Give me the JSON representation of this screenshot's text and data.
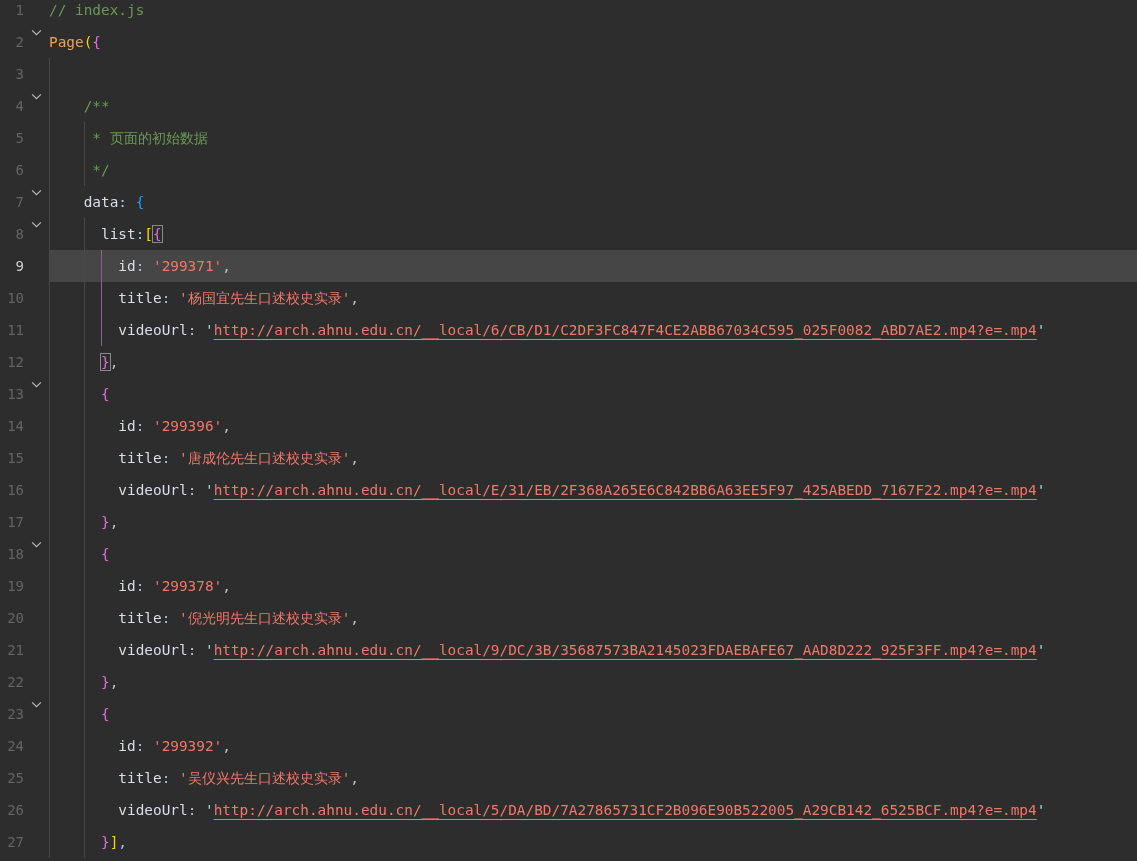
{
  "editor": {
    "lines": [
      {
        "number": "1",
        "foldable": false,
        "current": false,
        "scope_highlight": false,
        "tokens": [
          {
            "kind": "comment",
            "text": "// index.js"
          }
        ]
      },
      {
        "number": "2",
        "foldable": true,
        "current": false,
        "scope_highlight": false,
        "tokens": [
          {
            "kind": "function",
            "text": "Page"
          },
          {
            "kind": "bracket-gold",
            "text": "("
          },
          {
            "kind": "bracket-pink",
            "text": "{"
          }
        ]
      },
      {
        "number": "3",
        "foldable": false,
        "current": false,
        "scope_highlight": false
      },
      {
        "number": "4",
        "foldable": true,
        "current": false,
        "scope_highlight": false,
        "tokens": [
          {
            "kind": "comment",
            "text": "    /**"
          }
        ]
      },
      {
        "number": "5",
        "foldable": false,
        "current": false,
        "scope_highlight": false,
        "tokens": [
          {
            "kind": "comment",
            "text": "     * 页面的初始数据"
          }
        ]
      },
      {
        "number": "6",
        "foldable": false,
        "current": false,
        "scope_highlight": false,
        "tokens": [
          {
            "kind": "comment",
            "text": "     */"
          }
        ]
      },
      {
        "number": "7",
        "foldable": true,
        "current": false,
        "scope_highlight": false,
        "tokens": [
          {
            "kind": "property",
            "text": "    data"
          },
          {
            "kind": "punct",
            "text": ": "
          },
          {
            "kind": "bracket-blue",
            "text": "{"
          }
        ]
      },
      {
        "number": "8",
        "foldable": true,
        "current": false,
        "scope_highlight": false,
        "tokens": [
          {
            "kind": "property",
            "text": "      list"
          },
          {
            "kind": "punct",
            "text": ":"
          },
          {
            "kind": "bracket-gold",
            "text": "["
          },
          {
            "kind": "bracket-pink",
            "text": "{",
            "matched": true
          }
        ]
      },
      {
        "number": "9",
        "foldable": false,
        "current": true,
        "scope_highlight": true,
        "tokens": [
          {
            "kind": "property",
            "text": "        id"
          },
          {
            "kind": "punct",
            "text": ": "
          },
          {
            "kind": "string",
            "text": "'299371'"
          },
          {
            "kind": "punct",
            "text": ","
          }
        ]
      },
      {
        "number": "10",
        "foldable": false,
        "current": false,
        "scope_highlight": true,
        "tokens": [
          {
            "kind": "property",
            "text": "        title"
          },
          {
            "kind": "punct",
            "text": ": "
          },
          {
            "kind": "string",
            "text": "'杨国宜先生口述校史实录'"
          },
          {
            "kind": "punct",
            "text": ","
          }
        ]
      },
      {
        "number": "11",
        "foldable": false,
        "current": false,
        "scope_highlight": true,
        "tokens": [
          {
            "kind": "property",
            "text": "        videoUrl"
          },
          {
            "kind": "punct",
            "text": ": "
          },
          {
            "kind": "quote",
            "text": "'"
          },
          {
            "kind": "link",
            "text": "http://arch.ahnu.edu.cn/__local/6/CB/D1/C2DF3FC847F4CE2ABB67034C595_025F0082_ABD7AE2.mp4?e=.mp4"
          },
          {
            "kind": "quote",
            "text": "'"
          }
        ]
      },
      {
        "number": "12",
        "foldable": false,
        "current": false,
        "scope_highlight": false,
        "tokens": [
          {
            "kind": "bracket-pink",
            "text": "      }",
            "matched": true
          },
          {
            "kind": "punct",
            "text": ","
          }
        ]
      },
      {
        "number": "13",
        "foldable": true,
        "current": false,
        "scope_highlight": false,
        "tokens": [
          {
            "kind": "bracket-pink",
            "text": "      {"
          }
        ]
      },
      {
        "number": "14",
        "foldable": false,
        "current": false,
        "scope_highlight": false,
        "tokens": [
          {
            "kind": "property",
            "text": "        id"
          },
          {
            "kind": "punct",
            "text": ": "
          },
          {
            "kind": "string",
            "text": "'299396'"
          },
          {
            "kind": "punct",
            "text": ","
          }
        ]
      },
      {
        "number": "15",
        "foldable": false,
        "current": false,
        "scope_highlight": false,
        "tokens": [
          {
            "kind": "property",
            "text": "        title"
          },
          {
            "kind": "punct",
            "text": ": "
          },
          {
            "kind": "string",
            "text": "'唐成伦先生口述校史实录'"
          },
          {
            "kind": "punct",
            "text": ","
          }
        ]
      },
      {
        "number": "16",
        "foldable": false,
        "current": false,
        "scope_highlight": false,
        "tokens": [
          {
            "kind": "property",
            "text": "        videoUrl"
          },
          {
            "kind": "punct",
            "text": ": "
          },
          {
            "kind": "quote",
            "text": "'"
          },
          {
            "kind": "link",
            "text": "http://arch.ahnu.edu.cn/__local/E/31/EB/2F368A265E6C842BB6A63EE5F97_425ABEDD_7167F22.mp4?e=.mp4"
          },
          {
            "kind": "quote",
            "text": "'"
          }
        ]
      },
      {
        "number": "17",
        "foldable": false,
        "current": false,
        "scope_highlight": false,
        "tokens": [
          {
            "kind": "bracket-pink",
            "text": "      }"
          },
          {
            "kind": "punct",
            "text": ","
          }
        ]
      },
      {
        "number": "18",
        "foldable": true,
        "current": false,
        "scope_highlight": false,
        "tokens": [
          {
            "kind": "bracket-pink",
            "text": "      {"
          }
        ]
      },
      {
        "number": "19",
        "foldable": false,
        "current": false,
        "scope_highlight": false,
        "tokens": [
          {
            "kind": "property",
            "text": "        id"
          },
          {
            "kind": "punct",
            "text": ": "
          },
          {
            "kind": "string",
            "text": "'299378'"
          },
          {
            "kind": "punct",
            "text": ","
          }
        ]
      },
      {
        "number": "20",
        "foldable": false,
        "current": false,
        "scope_highlight": false,
        "tokens": [
          {
            "kind": "property",
            "text": "        title"
          },
          {
            "kind": "punct",
            "text": ": "
          },
          {
            "kind": "string",
            "text": "'倪光明先生口述校史实录'"
          },
          {
            "kind": "punct",
            "text": ","
          }
        ]
      },
      {
        "number": "21",
        "foldable": false,
        "current": false,
        "scope_highlight": false,
        "tokens": [
          {
            "kind": "property",
            "text": "        videoUrl"
          },
          {
            "kind": "punct",
            "text": ": "
          },
          {
            "kind": "quote",
            "text": "'"
          },
          {
            "kind": "link",
            "text": "http://arch.ahnu.edu.cn/__local/9/DC/3B/35687573BA2145023FDAEBAFE67_AAD8D222_925F3FF.mp4?e=.mp4"
          },
          {
            "kind": "quote",
            "text": "'"
          }
        ]
      },
      {
        "number": "22",
        "foldable": false,
        "current": false,
        "scope_highlight": false,
        "tokens": [
          {
            "kind": "bracket-pink",
            "text": "      }"
          },
          {
            "kind": "punct",
            "text": ","
          }
        ]
      },
      {
        "number": "23",
        "foldable": true,
        "current": false,
        "scope_highlight": false,
        "tokens": [
          {
            "kind": "bracket-pink",
            "text": "      {"
          }
        ]
      },
      {
        "number": "24",
        "foldable": false,
        "current": false,
        "scope_highlight": false,
        "tokens": [
          {
            "kind": "property",
            "text": "        id"
          },
          {
            "kind": "punct",
            "text": ": "
          },
          {
            "kind": "string",
            "text": "'299392'"
          },
          {
            "kind": "punct",
            "text": ","
          }
        ]
      },
      {
        "number": "25",
        "foldable": false,
        "current": false,
        "scope_highlight": false,
        "tokens": [
          {
            "kind": "property",
            "text": "        title"
          },
          {
            "kind": "punct",
            "text": ": "
          },
          {
            "kind": "string",
            "text": "'吴仪兴先生口述校史实录'"
          },
          {
            "kind": "punct",
            "text": ","
          }
        ]
      },
      {
        "number": "26",
        "foldable": false,
        "current": false,
        "scope_highlight": false,
        "tokens": [
          {
            "kind": "property",
            "text": "        videoUrl"
          },
          {
            "kind": "punct",
            "text": ": "
          },
          {
            "kind": "quote",
            "text": "'"
          },
          {
            "kind": "link",
            "text": "http://arch.ahnu.edu.cn/__local/5/DA/BD/7A27865731CF2B096E90B522005_A29CB142_6525BCF.mp4?e=.mp4"
          },
          {
            "kind": "quote",
            "text": "'"
          }
        ]
      },
      {
        "number": "27",
        "foldable": false,
        "current": false,
        "scope_highlight": false,
        "tokens": [
          {
            "kind": "bracket-pink",
            "text": "      }"
          },
          {
            "kind": "bracket-gold",
            "text": "]"
          },
          {
            "kind": "punct",
            "text": ","
          }
        ]
      }
    ]
  }
}
